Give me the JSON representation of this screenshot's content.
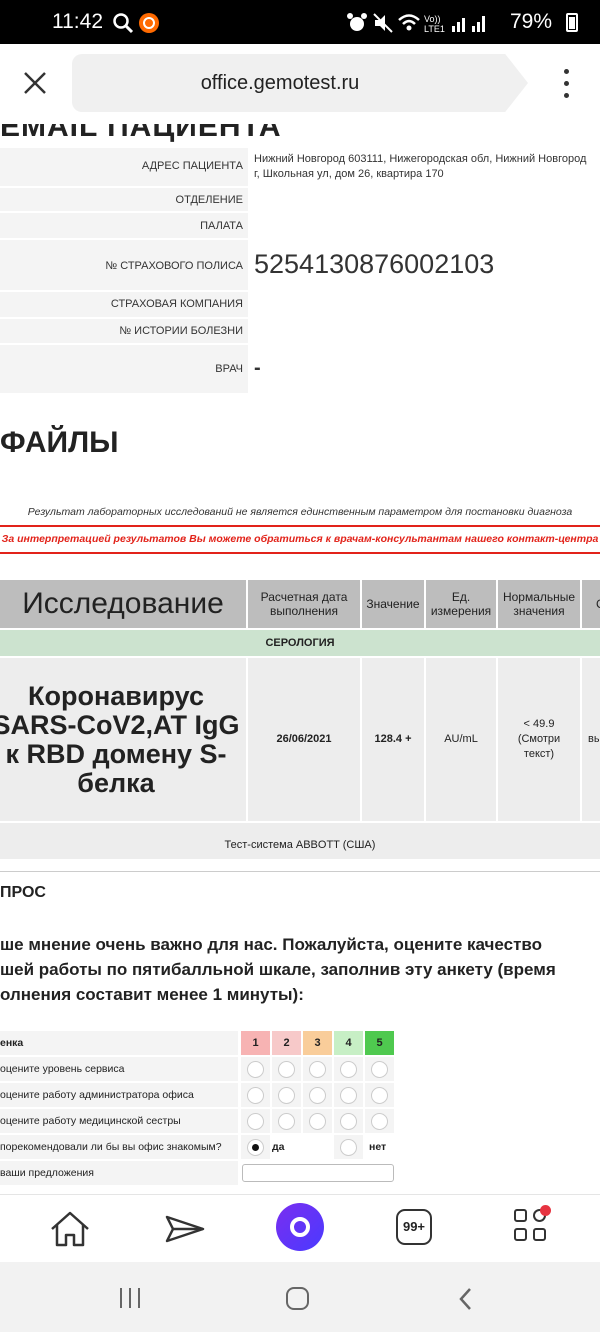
{
  "status_bar": {
    "time": "11:42",
    "battery": "79%",
    "icons": [
      "search-icon",
      "app-notification-icon",
      "alarm-icon",
      "mute-icon",
      "wifi-icon",
      "volte-icon",
      "signal-icon",
      "battery-icon"
    ]
  },
  "browser": {
    "url": "office.gemotest.ru"
  },
  "patient": {
    "cut_title": "EMAIL ПАЦИЕНТА",
    "rows": [
      {
        "label": "АДРЕС ПАЦИЕНТА",
        "value": "Нижний Новгород 603111, Нижегородская обл, Нижний Новгород г, Школьная ул, дом 26, квартира 170"
      },
      {
        "label": "ОТДЕЛЕНИЕ",
        "value": ""
      },
      {
        "label": "ПАЛАТА",
        "value": ""
      },
      {
        "label": "№ СТРАХОВОГО ПОЛИСА",
        "value": "5254130876002103"
      },
      {
        "label": "СТРАХОВАЯ КОМПАНИЯ",
        "value": ""
      },
      {
        "label": "№ ИСТОРИИ БОЛЕЗНИ",
        "value": ""
      },
      {
        "label": "ВРАЧ",
        "value": "-"
      }
    ]
  },
  "files_title": "ФАЙЛЫ",
  "notice": {
    "line1": "Результат лабораторных исследований не является единственным параметром для постановки диагноза",
    "line2": "За интерпретацией результатов Вы можете обратиться к врачам-консультантам нашего контакт-центра"
  },
  "results": {
    "headers": {
      "study": "Исследование",
      "date": "Расчетная дата выполнения",
      "value": "Значение",
      "unit": "Ед. измерения",
      "norm": "Нормальные значения",
      "comment": "С"
    },
    "section": "СЕРОЛОГИЯ",
    "row": {
      "name_lines": [
        "Коронавирус",
        "SARS-CoV2,AT IgG",
        "к RBD домену S-",
        "белка"
      ],
      "date": "26/06/2021",
      "value": "128.4 +",
      "unit": "AU/mL",
      "norm_lines": [
        "< 49.9",
        "(Смотри",
        "текст)"
      ],
      "comment": "вы"
    },
    "test_system": "Тест-система ABBOTT (США)"
  },
  "poll": {
    "title": "ПРОС",
    "text": "ше мнение очень важно для нас. Пожалуйста, оцените качество шей работы по пятибалльной шкале, заполнив эту анкету (время олнения составит менее 1 минуты):",
    "header_label": "енка",
    "scores": [
      "1",
      "2",
      "3",
      "4",
      "5"
    ],
    "score_colors": [
      "#f7b3b3",
      "#f7c9c9",
      "#f9cd9a",
      "#c7efc5",
      "#4fc94f"
    ],
    "questions": [
      "оцените уровень сервиса",
      "оцените работу администратора офиса",
      "оцените работу медицинской сестры"
    ],
    "recommend_question": "порекомендовали ли бы вы офис знакомым?",
    "yes": "да",
    "no": "нет",
    "suggestions": "ваши предложения"
  }
}
